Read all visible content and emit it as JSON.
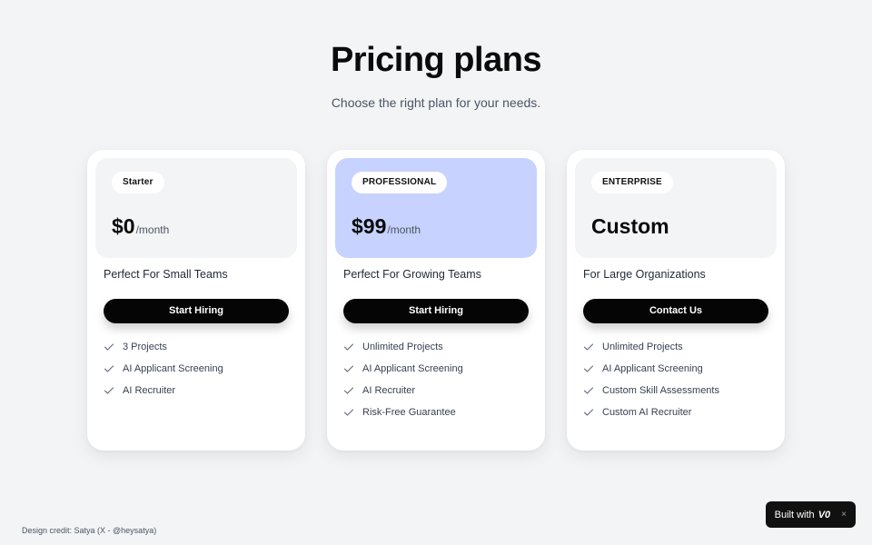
{
  "header": {
    "title": "Pricing plans",
    "subtitle": "Choose the right plan for your needs."
  },
  "plans": [
    {
      "badge": "Starter",
      "price": "$0",
      "price_suffix": "/month",
      "tagline": "Perfect For Small Teams",
      "cta": "Start Hiring",
      "features": [
        "3 Projects",
        "AI Applicant Screening",
        "AI Recruiter"
      ]
    },
    {
      "badge": "PROFESSIONAL",
      "price": "$99",
      "price_suffix": "/month",
      "tagline": "Perfect For Growing Teams",
      "cta": "Start Hiring",
      "features": [
        "Unlimited Projects",
        "AI Applicant Screening",
        "AI Recruiter",
        "Risk-Free Guarantee"
      ]
    },
    {
      "badge": "ENTERPRISE",
      "price": "Custom",
      "price_suffix": "",
      "tagline": "For Large Organizations",
      "cta": "Contact Us",
      "features": [
        "Unlimited Projects",
        "AI Applicant Screening",
        "Custom Skill Assessments",
        "Custom AI Recruiter"
      ]
    }
  ],
  "footer": {
    "credit": "Design credit: Satya (X - @heysatya)",
    "built_with": "Built with",
    "built_with_logo": "V0",
    "close_glyph": "×"
  },
  "icons": {
    "feature": "check-icon",
    "close": "close-icon"
  },
  "colors": {
    "background": "#f3f4f6",
    "highlight": "#c7d2fe",
    "button": "#050505",
    "card": "#ffffff"
  }
}
